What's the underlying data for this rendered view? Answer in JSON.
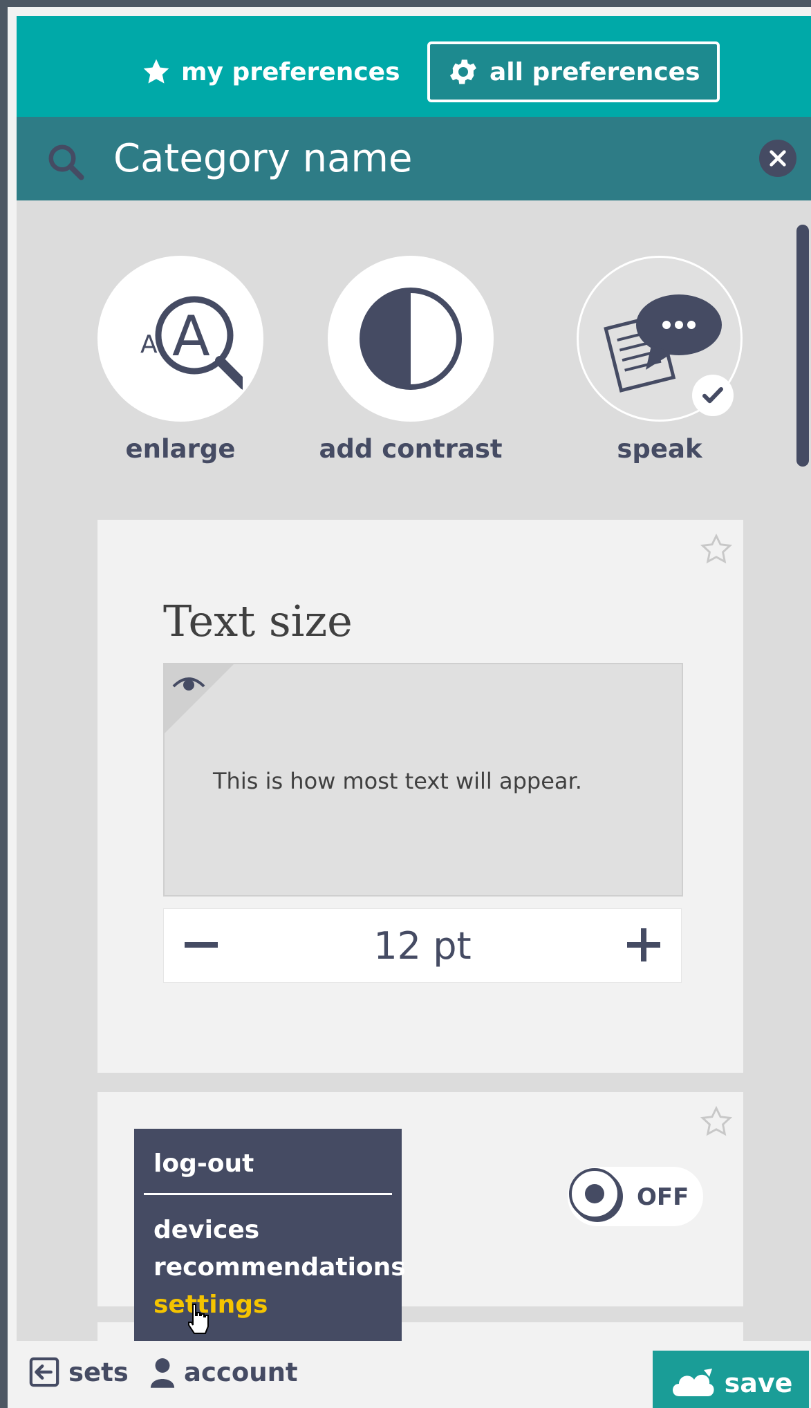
{
  "tabs": {
    "my_preferences": "my preferences",
    "all_preferences": "all preferences"
  },
  "search": {
    "placeholder": "Category name"
  },
  "quick_actions": [
    {
      "label": "enlarge",
      "icon": "magnifier-icon"
    },
    {
      "label": "add contrast",
      "icon": "contrast-icon"
    },
    {
      "label": "speak",
      "icon": "speech-bubble-icon",
      "selected": true
    }
  ],
  "text_size_card": {
    "title": "Text size",
    "preview_text": "This is how most text will appear.",
    "value": "12 pt"
  },
  "toggle": {
    "label": "OFF",
    "state": false
  },
  "account_menu": {
    "logout": "log-out",
    "items": [
      "devices",
      "recommendations",
      "settings"
    ],
    "highlighted": "settings"
  },
  "footer": {
    "sets": "sets",
    "account": "account",
    "save": "save"
  },
  "colors": {
    "teal_header": "#00a9a8",
    "search_bar": "#2e7c86",
    "navy": "#454b63",
    "highlight": "#f5c400",
    "save_button": "#1a9d97"
  }
}
